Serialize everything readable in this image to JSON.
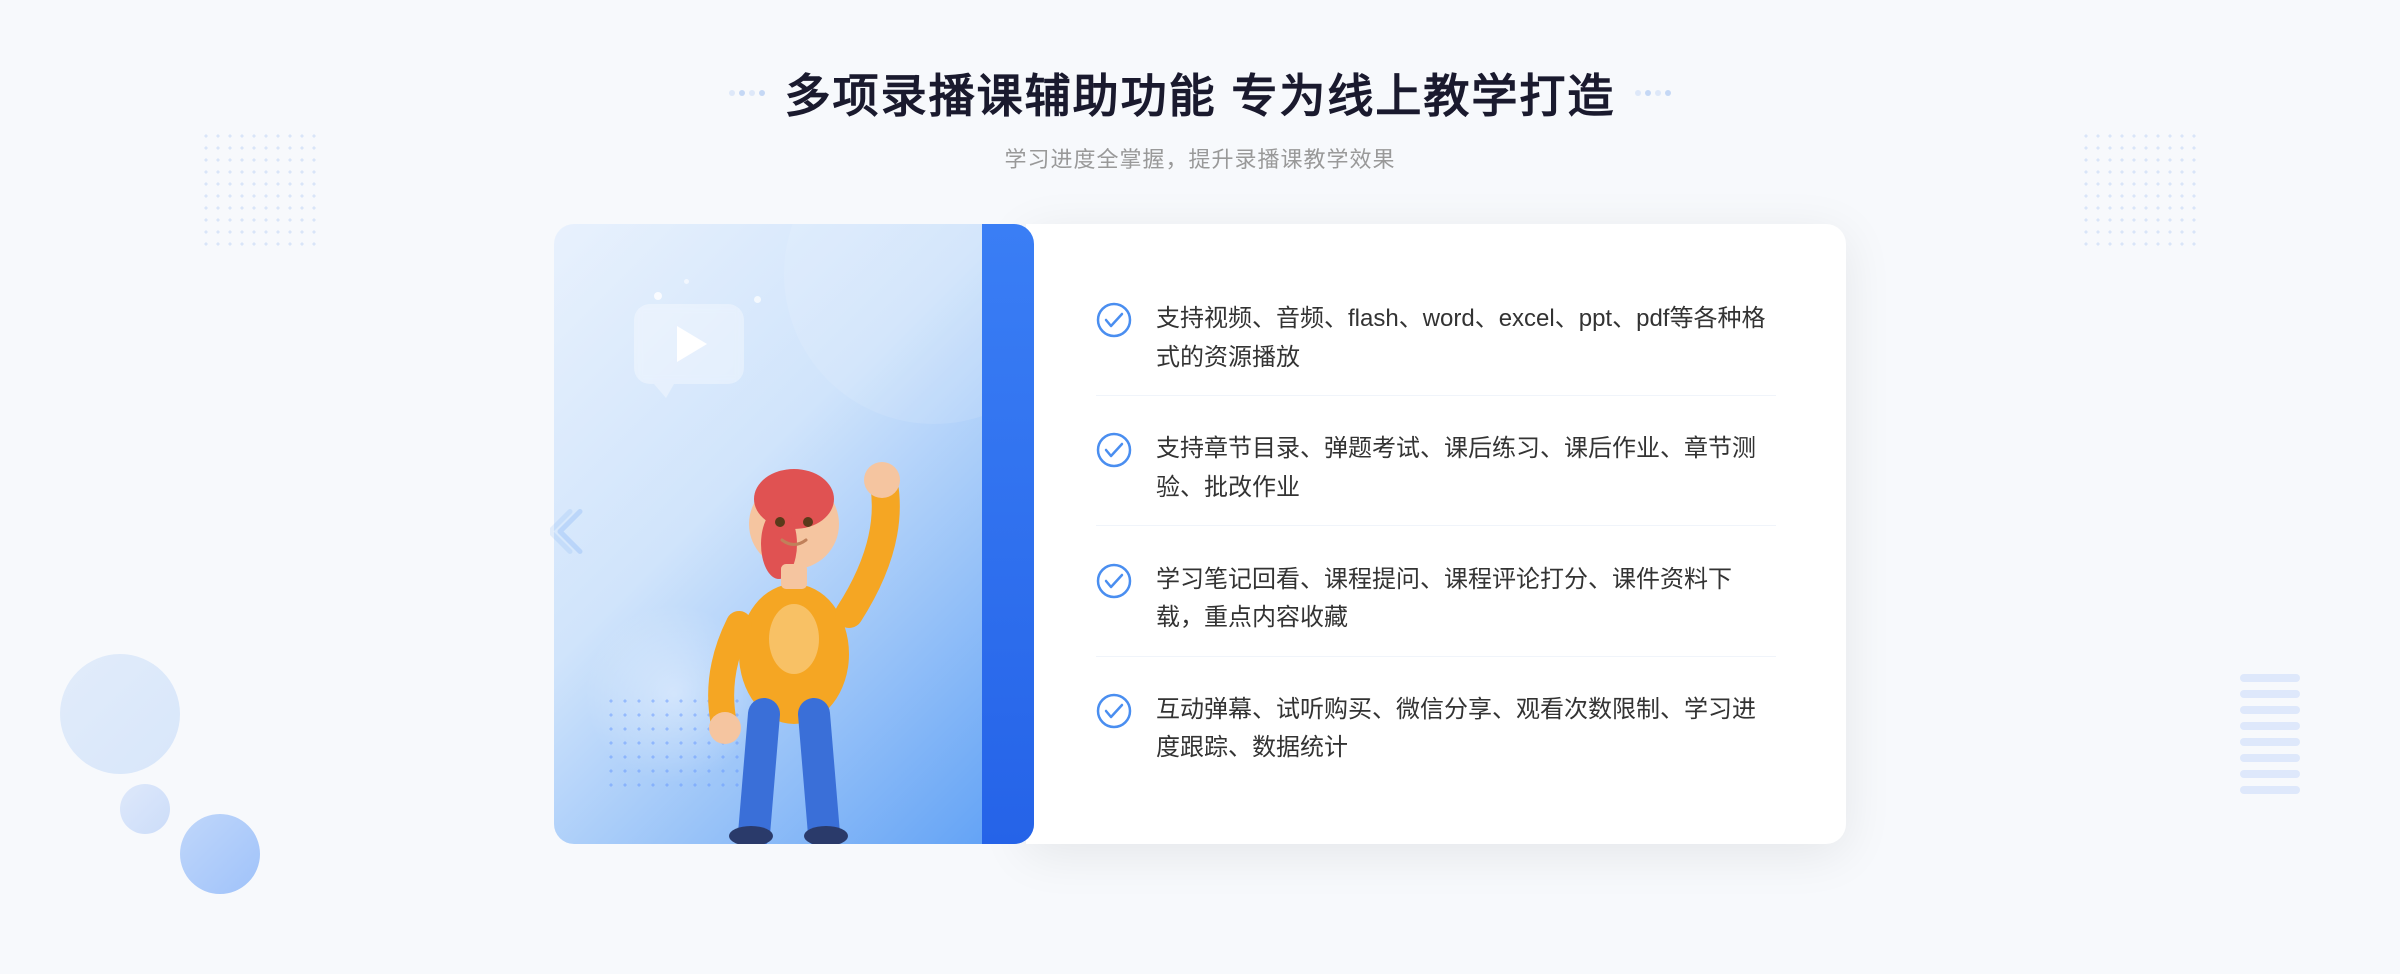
{
  "header": {
    "title": "多项录播课辅助功能 专为线上教学打造",
    "subtitle": "学习进度全掌握，提升录播课教学效果"
  },
  "features": [
    {
      "id": 1,
      "text": "支持视频、音频、flash、word、excel、ppt、pdf等各种格式的资源播放"
    },
    {
      "id": 2,
      "text": "支持章节目录、弹题考试、课后练习、课后作业、章节测验、批改作业"
    },
    {
      "id": 3,
      "text": "学习笔记回看、课程提问、课程评论打分、课件资料下载，重点内容收藏"
    },
    {
      "id": 4,
      "text": "互动弹幕、试听购买、微信分享、观看次数限制、学习进度跟踪、数据统计"
    }
  ],
  "decoration": {
    "chevron_symbol": "《",
    "play_aria": "play-button"
  },
  "colors": {
    "primary_blue": "#4a8ef0",
    "dark_blue": "#2563e8",
    "light_blue": "#a8c8fa",
    "text_dark": "#1a1a2e",
    "text_gray": "#999999",
    "text_feature": "#333333"
  }
}
